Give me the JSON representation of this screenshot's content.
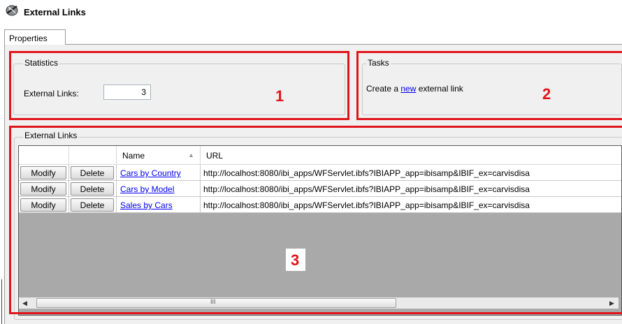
{
  "window": {
    "title": "External Links",
    "title_icon": "external-links-icon"
  },
  "tabs": [
    {
      "label": "Properties"
    }
  ],
  "statistics": {
    "legend": "Statistics",
    "external_links_label": "External Links:",
    "external_links_value": "3",
    "annotation": "1"
  },
  "tasks": {
    "legend": "Tasks",
    "create_prefix": "Create a",
    "create_link": "new",
    "create_suffix": "external link",
    "annotation": "2"
  },
  "links": {
    "legend": "External Links",
    "annotation": "3",
    "columns": [
      {
        "label": ""
      },
      {
        "label": ""
      },
      {
        "label": "Name",
        "sort": "ascending"
      },
      {
        "label": "URL"
      }
    ],
    "rows": [
      {
        "modify": "Modify",
        "delete": "Delete",
        "name": "Cars by Country",
        "url": "http://localhost:8080/ibi_apps/WFServlet.ibfs?IBIAPP_app=ibisamp&IBIF_ex=carvisdisa"
      },
      {
        "modify": "Modify",
        "delete": "Delete",
        "name": "Cars by Model",
        "url": "http://localhost:8080/ibi_apps/WFServlet.ibfs?IBIAPP_app=ibisamp&IBIF_ex=carvisdisa"
      },
      {
        "modify": "Modify",
        "delete": "Delete",
        "name": "Sales by Cars",
        "url": "http://localhost:8080/ibi_apps/WFServlet.ibfs?IBIAPP_app=ibisamp&IBIF_ex=carvisdisa"
      }
    ],
    "scrollbar": {
      "thumb_grip": "III"
    }
  },
  "colors": {
    "annotation_red": "#e0151b",
    "link_blue": "#0000ee",
    "grid_empty": "#a9a9a9"
  }
}
